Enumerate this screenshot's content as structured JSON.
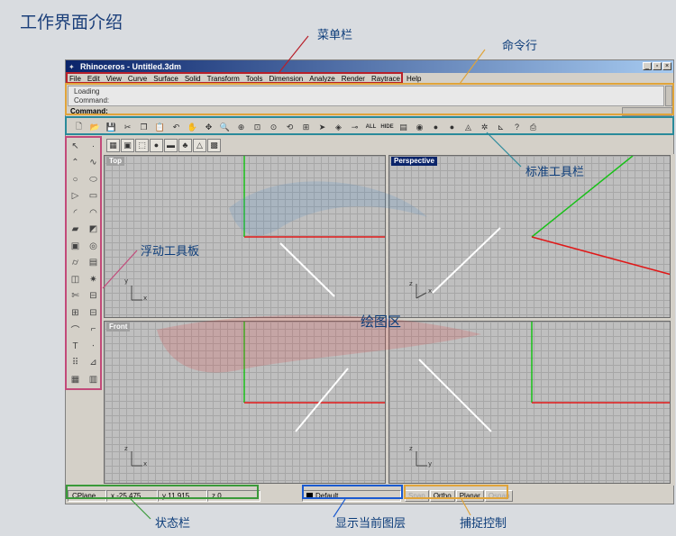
{
  "page": {
    "title": "工作界面介绍"
  },
  "window": {
    "title": "Rhinoceros - Untitled.3dm",
    "controls": [
      "_",
      "▫",
      "×"
    ]
  },
  "menu": [
    {
      "label": "File"
    },
    {
      "label": "Edit"
    },
    {
      "label": "View"
    },
    {
      "label": "Curve"
    },
    {
      "label": "Surface"
    },
    {
      "label": "Solid"
    },
    {
      "label": "Transform"
    },
    {
      "label": "Tools"
    },
    {
      "label": "Dimension"
    },
    {
      "label": "Analyze"
    },
    {
      "label": "Render"
    },
    {
      "label": "Raytrace"
    },
    {
      "label": "Help"
    }
  ],
  "command": {
    "history_line1": "Loading",
    "history_line2": "Command:",
    "prompt": "Command:"
  },
  "std_toolbar": [
    {
      "icon": "new-file-icon",
      "glyph": "🗋"
    },
    {
      "icon": "open-folder-icon",
      "glyph": "📂"
    },
    {
      "icon": "save-icon",
      "glyph": "💾"
    },
    {
      "icon": "cut-icon",
      "glyph": "✂"
    },
    {
      "icon": "copy-icon",
      "glyph": "❐"
    },
    {
      "icon": "paste-icon",
      "glyph": "📋"
    },
    {
      "icon": "undo-icon",
      "glyph": "↶"
    },
    {
      "icon": "pan-hand-icon",
      "glyph": "✋"
    },
    {
      "icon": "rotate-view-icon",
      "glyph": "✥"
    },
    {
      "icon": "zoom-dynamic-icon",
      "glyph": "🔍"
    },
    {
      "icon": "zoom-window-icon",
      "glyph": "⊕"
    },
    {
      "icon": "zoom-extents-icon",
      "glyph": "⊡"
    },
    {
      "icon": "zoom-selected-icon",
      "glyph": "⊙"
    },
    {
      "icon": "undo-view-icon",
      "glyph": "⟲"
    },
    {
      "icon": "four-viewports-icon",
      "glyph": "⊞"
    },
    {
      "icon": "select-objects-icon",
      "glyph": "➤"
    },
    {
      "icon": "show-objects-icon",
      "glyph": "◈"
    },
    {
      "icon": "lock-objects-icon",
      "glyph": "⊸"
    },
    {
      "icon": "select-all-icon",
      "glyph": "ALL"
    },
    {
      "icon": "hide-objects-icon",
      "glyph": "HIDE"
    },
    {
      "icon": "layers-icon",
      "glyph": "▤"
    },
    {
      "icon": "color-wheel-icon",
      "glyph": "◉"
    },
    {
      "icon": "shade-sphere-icon",
      "glyph": "●"
    },
    {
      "icon": "render-sphere-icon",
      "glyph": "●"
    },
    {
      "icon": "light-icon",
      "glyph": "◬"
    },
    {
      "icon": "tree-render-icon",
      "glyph": "✲"
    },
    {
      "icon": "dimension-icon",
      "glyph": "⊾"
    },
    {
      "icon": "help-icon",
      "glyph": "?"
    },
    {
      "icon": "properties-icon",
      "glyph": "⎙"
    }
  ],
  "sub_toolbar": [
    {
      "icon": "render-grid-icon",
      "glyph": "▦"
    },
    {
      "icon": "render-preview-icon",
      "glyph": "▣"
    },
    {
      "icon": "render-window-icon",
      "glyph": "⬚"
    },
    {
      "icon": "green-sphere-icon",
      "glyph": "●"
    },
    {
      "icon": "ground-plane-icon",
      "glyph": "▬"
    },
    {
      "icon": "tree-icon",
      "glyph": "♣"
    },
    {
      "icon": "spotlight-icon",
      "glyph": "△"
    },
    {
      "icon": "render-settings-icon",
      "glyph": "▩"
    }
  ],
  "floating_toolbar": [
    {
      "icon": "select-arrow-icon",
      "glyph": "↖"
    },
    {
      "icon": "point-icon",
      "glyph": "·"
    },
    {
      "icon": "polyline-icon",
      "glyph": "⌃"
    },
    {
      "icon": "curve-icon",
      "glyph": "∿"
    },
    {
      "icon": "circle-icon",
      "glyph": "○"
    },
    {
      "icon": "ellipse-icon",
      "glyph": "⬭"
    },
    {
      "icon": "polygon-icon",
      "glyph": "▷"
    },
    {
      "icon": "rectangle-icon",
      "glyph": "▭"
    },
    {
      "icon": "arc-icon",
      "glyph": "◜"
    },
    {
      "icon": "freeform-icon",
      "glyph": "◠"
    },
    {
      "icon": "surface-icon",
      "glyph": "▰"
    },
    {
      "icon": "loft-icon",
      "glyph": "◩"
    },
    {
      "icon": "box-icon",
      "glyph": "▣"
    },
    {
      "icon": "sphere-solid-icon",
      "glyph": "◎"
    },
    {
      "icon": "cylinder-icon",
      "glyph": "⌭"
    },
    {
      "icon": "extrude-icon",
      "glyph": "▤"
    },
    {
      "icon": "mesh-icon",
      "glyph": "◫"
    },
    {
      "icon": "explode-icon",
      "glyph": "✷"
    },
    {
      "icon": "trim-icon",
      "glyph": "✄"
    },
    {
      "icon": "split-icon",
      "glyph": "⊟"
    },
    {
      "icon": "group-icon",
      "glyph": "⊞"
    },
    {
      "icon": "ungroup-icon",
      "glyph": "⊟"
    },
    {
      "icon": "fillet-icon",
      "glyph": "⌒"
    },
    {
      "icon": "chamfer-icon",
      "glyph": "⌐"
    },
    {
      "icon": "text-icon",
      "glyph": "T"
    },
    {
      "icon": "dot-icon",
      "glyph": "⋅"
    },
    {
      "icon": "array-icon",
      "glyph": "⠿"
    },
    {
      "icon": "dimension-tool-icon",
      "glyph": "⊿"
    },
    {
      "icon": "analyze-icon",
      "glyph": "▦"
    },
    {
      "icon": "snapshot-icon",
      "glyph": "▥"
    }
  ],
  "viewports": [
    {
      "id": "top",
      "label": "Top",
      "active": false,
      "axis1": "y",
      "axis2": "x"
    },
    {
      "id": "perspective",
      "label": "Perspective",
      "active": true,
      "axis1": "z",
      "axis2": "x"
    },
    {
      "id": "front",
      "label": "Front",
      "active": false,
      "axis1": "z",
      "axis2": "x"
    },
    {
      "id": "right",
      "label": "",
      "active": false,
      "axis1": "z",
      "axis2": "y"
    }
  ],
  "status": {
    "cplane": "CPlane",
    "x": "x -25.475",
    "y": "y 11.915",
    "z": "z 0",
    "layer": "Default",
    "snap": "Snap",
    "ortho": "Ortho",
    "planar": "Planar",
    "osnap": "Osnap"
  },
  "annotations": {
    "menubar": "菜单栏",
    "command_line": "命令行",
    "std_toolbar": "标准工具栏",
    "floating_palette": "浮动工具板",
    "drawing_area": "绘图区",
    "status_bar": "状态栏",
    "current_layer": "显示当前图层",
    "snap_control": "捕捉控制"
  },
  "colors": {
    "menubar_highlight": "#b8202a",
    "command_highlight": "#e0a43a",
    "toolbar_highlight": "#2a8a9a",
    "floating_highlight": "#c24a7a",
    "status_highlight": "#3a9a3a",
    "layer_highlight": "#1a5ad0",
    "snap_highlight": "#e0a43a",
    "axis_x": "#e01818",
    "axis_y": "#18c018",
    "titlebar": "#0a246a"
  }
}
